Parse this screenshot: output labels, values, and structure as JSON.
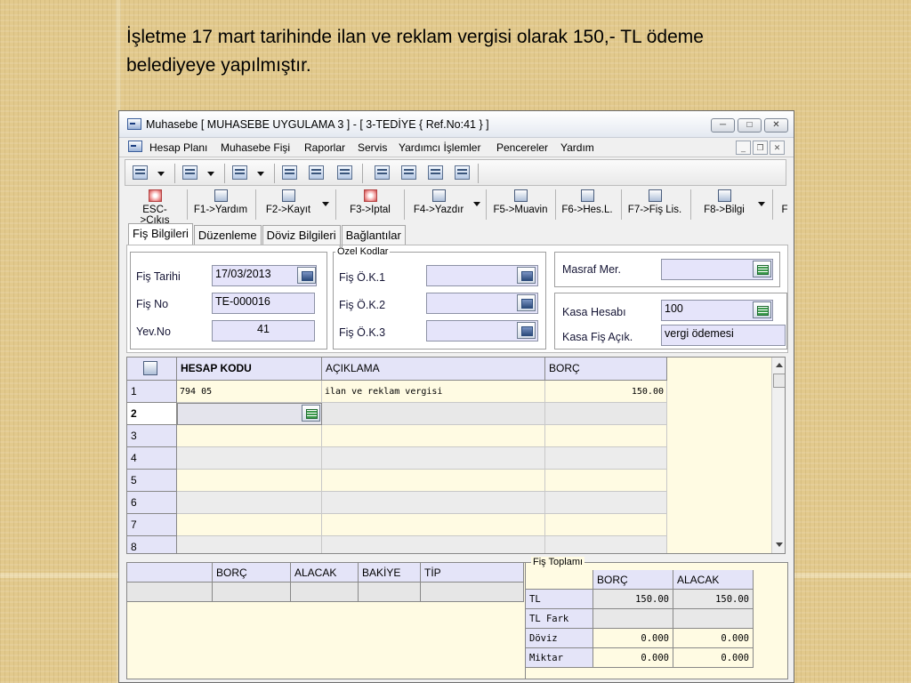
{
  "caption": {
    "line1": "İşletme 17 mart tarihinde ilan ve reklam vergisi olarak 150,- TL ödeme",
    "line2": "belediyeye yapılmıştır."
  },
  "window": {
    "title": "Muhasebe [ MUHASEBE UYGULAMA 3 ]  - [ 3-TEDİYE { Ref.No:41 } ]"
  },
  "menu": [
    "Hesap Planı",
    "Muhasebe Fişi",
    "Raporlar",
    "Servis",
    "Yardımcı İşlemler",
    "Pencereler",
    "Yardım"
  ],
  "toolbar2": [
    "ESC->Çıkış",
    "F1->Yardım",
    "F2->Kayıt",
    "F3->Iptal",
    "F4->Yazdır",
    "F5->Muavin",
    "F6->Hes.L.",
    "F7->Fiş Lis.",
    "F8->Bilgi",
    "F"
  ],
  "tabs": [
    "Fiş Bilgileri",
    "Düzenleme",
    "Döviz Bilgileri",
    "Bağlantılar"
  ],
  "form": {
    "fis_tarihi": {
      "label": "Fiş Tarihi",
      "value": "17/03/2013"
    },
    "fis_no": {
      "label": "Fiş No",
      "value": "TE-000016"
    },
    "yev_no": {
      "label": "Yev.No",
      "value": "41"
    },
    "ozel_kodlar": {
      "title": "Özel Kodlar",
      "ok1": "Fiş Ö.K.1",
      "ok2": "Fiş Ö.K.2",
      "ok3": "Fiş Ö.K.3"
    },
    "masraf_mer": {
      "label": "Masraf Mer.",
      "value": ""
    },
    "kasa_hesabi": {
      "label": "Kasa Hesabı",
      "value": "100"
    },
    "kasa_fis_acik": {
      "label": "Kasa Fiş Açık.",
      "value": "vergi ödemesi"
    }
  },
  "grid": {
    "columns": [
      "HESAP KODU",
      "AÇIKLAMA",
      "BORÇ"
    ],
    "rows": [
      {
        "n": "1",
        "hesap": "794 05",
        "aciklama": "ilan ve reklam vergisi",
        "borc": "150.00"
      },
      {
        "n": "2",
        "hesap": "",
        "aciklama": "",
        "borc": ""
      },
      {
        "n": "3",
        "hesap": "",
        "aciklama": "",
        "borc": ""
      },
      {
        "n": "4",
        "hesap": "",
        "aciklama": "",
        "borc": ""
      },
      {
        "n": "5",
        "hesap": "",
        "aciklama": "",
        "borc": ""
      },
      {
        "n": "6",
        "hesap": "",
        "aciklama": "",
        "borc": ""
      },
      {
        "n": "7",
        "hesap": "",
        "aciklama": "",
        "borc": ""
      },
      {
        "n": "8",
        "hesap": "",
        "aciklama": "",
        "borc": ""
      }
    ]
  },
  "bottom_left": {
    "columns": [
      "BORÇ",
      "ALACAK",
      "BAKİYE",
      "TİP"
    ]
  },
  "fis_toplami": {
    "title": "Fiş Toplamı",
    "columns": [
      "BORÇ",
      "ALACAK"
    ],
    "rows": [
      {
        "label": "TL",
        "borc": "150.00",
        "alacak": "150.00"
      },
      {
        "label": "TL Fark",
        "borc": "",
        "alacak": ""
      },
      {
        "label": "Döviz",
        "borc": "0.000",
        "alacak": "0.000"
      },
      {
        "label": "Miktar",
        "borc": "0.000",
        "alacak": "0.000"
      }
    ]
  }
}
